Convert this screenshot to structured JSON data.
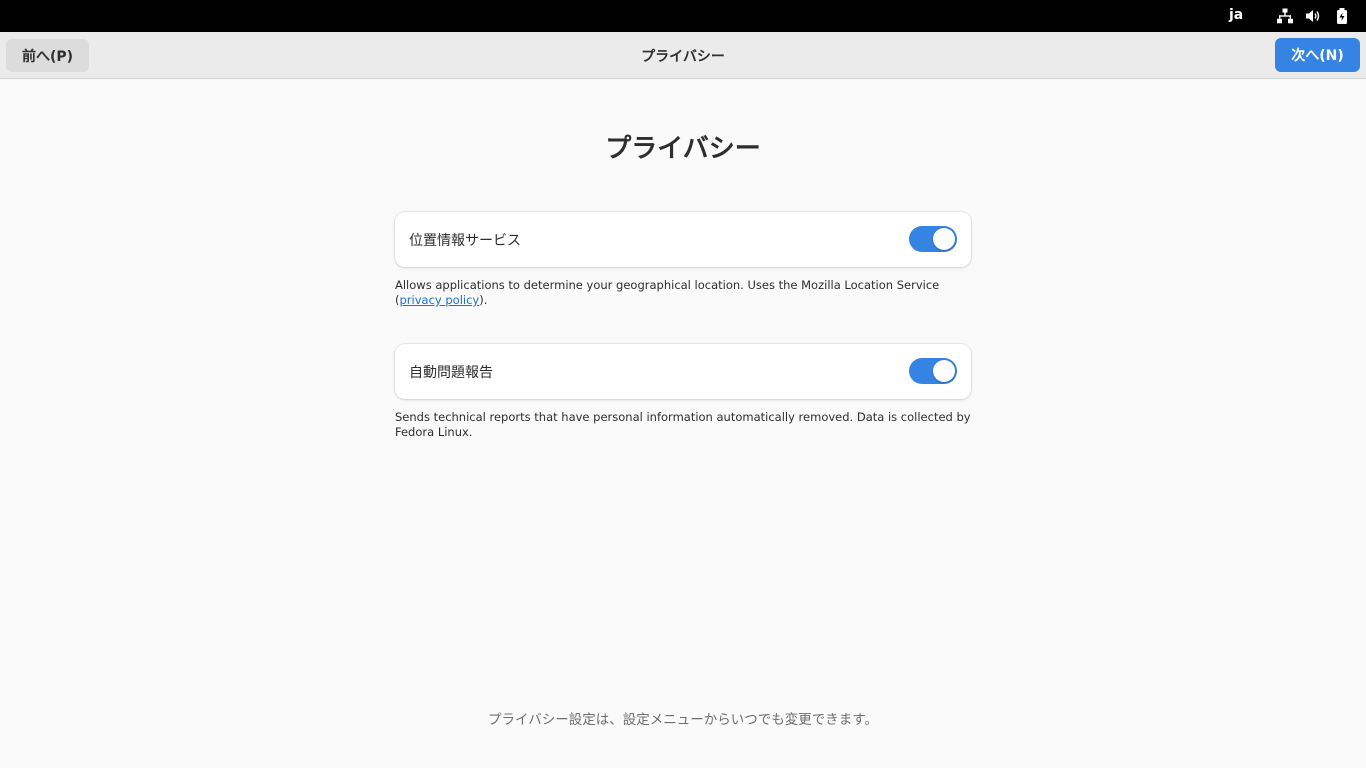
{
  "top_bar": {
    "language": "ja",
    "icons": [
      "network-icon",
      "volume-icon",
      "battery-icon"
    ]
  },
  "header": {
    "prev_label": "前へ(P)",
    "title": "プライバシー",
    "next_label": "次へ(N)"
  },
  "page": {
    "title": "プライバシー",
    "location": {
      "label": "位置情報サービス",
      "enabled": true,
      "description_pre": "Allows applications to determine your geographical location. Uses the Mozilla Location Service (",
      "description_link": "privacy policy",
      "description_post": ")."
    },
    "problem_reporting": {
      "label": "自動問題報告",
      "enabled": true,
      "description": "Sends technical reports that have personal information automatically removed. Data is collected by Fedora Linux."
    },
    "footer": "プライバシー設定は、設定メニューからいつでも変更できます。"
  },
  "colors": {
    "accent": "#3584e4",
    "link": "#1c71d8",
    "background": "#fafafa",
    "topbar": "#000000"
  }
}
